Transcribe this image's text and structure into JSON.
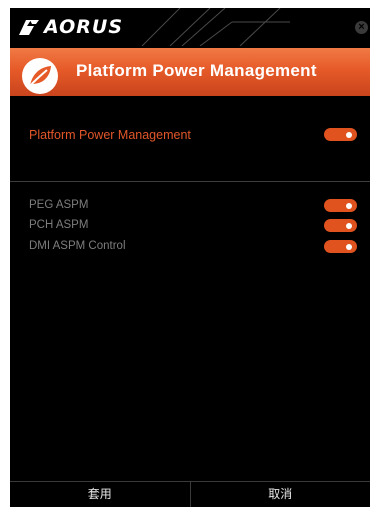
{
  "app": {
    "brand": "AORUS"
  },
  "header": {
    "title": "Platform Power Management"
  },
  "main_setting": {
    "label": "Platform Power Management",
    "enabled": true
  },
  "sub_settings": [
    {
      "label": "PEG ASPM",
      "enabled": true
    },
    {
      "label": "PCH ASPM",
      "enabled": true
    },
    {
      "label": "DMI ASPM Control",
      "enabled": true
    }
  ],
  "footer": {
    "apply_label": "套用",
    "cancel_label": "取消"
  },
  "colors": {
    "accent": "#e0531f",
    "main_label": "#e2562a",
    "sub_label": "#7d7d7d"
  },
  "icons": {
    "logo": "aorus-eagle-icon",
    "header": "leaf-icon",
    "close": "close-icon"
  }
}
